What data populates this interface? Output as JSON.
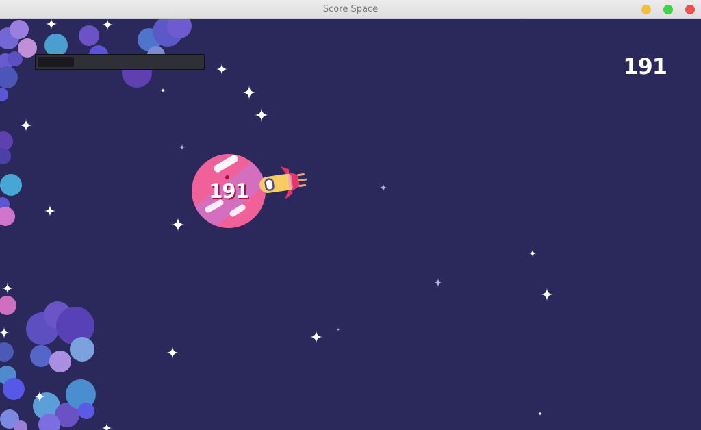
{
  "window": {
    "title": "Score Space"
  },
  "hud": {
    "score": "191",
    "progress": 0.22
  },
  "planet": {
    "score_label": "191"
  },
  "colors": {
    "background": "#2b285c",
    "planet": "#f0619a",
    "planet_band": "#d36fbe",
    "rocket_body": "#f8cc5e",
    "rocket_fin": "#e8336a"
  }
}
